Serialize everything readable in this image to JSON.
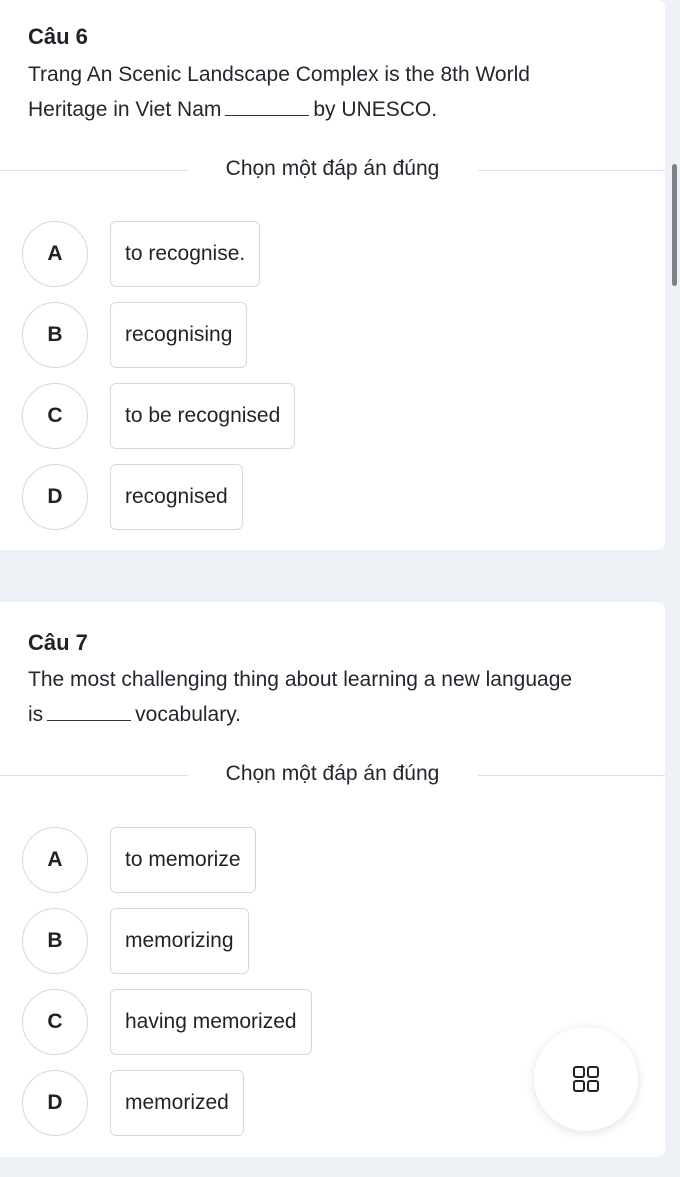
{
  "questions": [
    {
      "number": "Câu 6",
      "line1": "Trang An Scenic Landscape Complex is the 8th World",
      "line2_before": "Heritage in Viet Nam",
      "line2_after": "by UNESCO.",
      "instruction": "Chọn một đáp án đúng",
      "options": [
        {
          "letter": "A",
          "text": "to recognise."
        },
        {
          "letter": "B",
          "text": "recognising"
        },
        {
          "letter": "C",
          "text": "to be recognised"
        },
        {
          "letter": "D",
          "text": "recognised"
        }
      ]
    },
    {
      "number": "Câu 7",
      "line1": "The most challenging thing about learning a new language",
      "line2_before": "is",
      "line2_after": "vocabulary.",
      "instruction": "Chọn một đáp án đúng",
      "options": [
        {
          "letter": "A",
          "text": "to memorize"
        },
        {
          "letter": "B",
          "text": "memorizing"
        },
        {
          "letter": "C",
          "text": "having memorized"
        },
        {
          "letter": "D",
          "text": "memorized"
        }
      ]
    }
  ],
  "fab": {
    "icon": "grid-icon"
  }
}
